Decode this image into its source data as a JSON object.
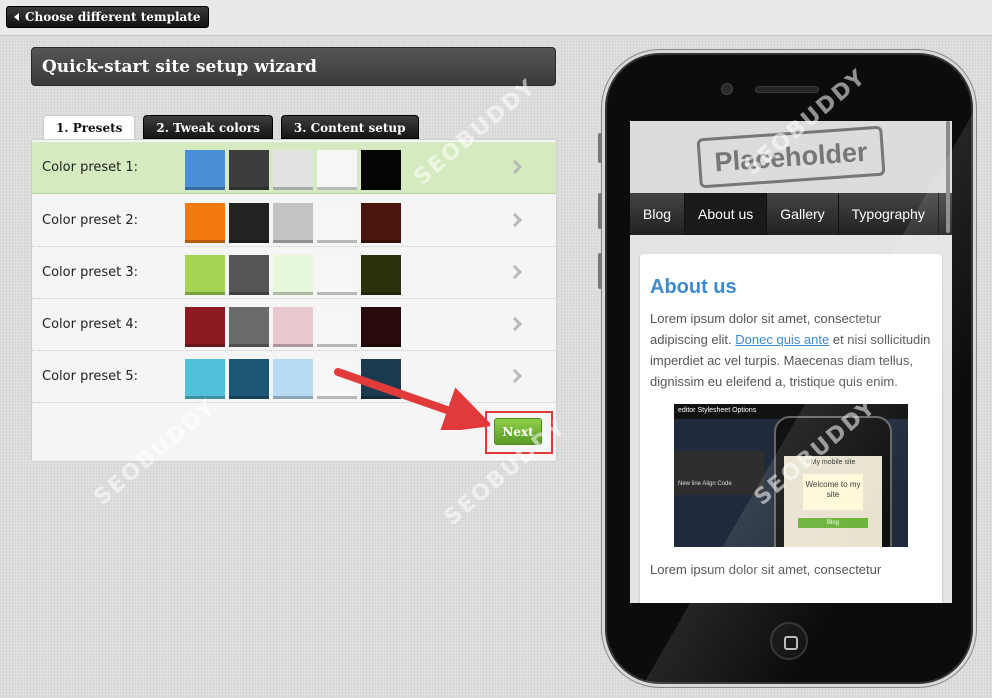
{
  "topbar": {
    "back_label": "Choose different template"
  },
  "wizard": {
    "title": "Quick-start site setup wizard"
  },
  "tabs": [
    "1. Presets",
    "2. Tweak colors",
    "3. Content setup"
  ],
  "presets": [
    {
      "label": "Color preset 1:",
      "colors": [
        "#4a90d9",
        "#3c3c3c",
        "#e2e2e2",
        "#f6f6f6",
        "#050505"
      ]
    },
    {
      "label": "Color preset 2:",
      "colors": [
        "#f47a0e",
        "#232323",
        "#c3c3c3",
        "#f6f6f6",
        "#4a160b"
      ]
    },
    {
      "label": "Color preset 3:",
      "colors": [
        "#a3d553",
        "#555555",
        "#e7f7da",
        "#f6f6f6",
        "#2b330c"
      ]
    },
    {
      "label": "Color preset 4:",
      "colors": [
        "#8c1a23",
        "#6a6a6a",
        "#e8c9cf",
        "#f6f6f6",
        "#2a0a0d"
      ]
    },
    {
      "label": "Color preset 5:",
      "colors": [
        "#4fc1d8",
        "#1b5775",
        "#b5dcf3",
        "#f6f6f6",
        "#1b3a4e"
      ]
    }
  ],
  "next_label": "Next",
  "mobile": {
    "logo": "Placeholder",
    "nav": [
      "Blog",
      "About us",
      "Gallery",
      "Typography"
    ],
    "heading": "About us",
    "para_pre": "Lorem ipsum dolor sit amet, consectetur adipiscing elit. ",
    "link": "Donec quis ante",
    "para_post": " et nisi sollicitudin imperdiet ac vel turpis. Maecenas diam tellus, dignissim eu eleifend a, tristique quis enim.",
    "tail": "Lorem ipsum dolor sit amet, consectetur",
    "img_bar": "editor   Stylesheet   Options",
    "img_pane": "New line   Align   Code",
    "img_title": "My mobile site",
    "img_note": "Welcome to my site",
    "img_btn": "Blog"
  },
  "watermark": "SEOBUDDY"
}
